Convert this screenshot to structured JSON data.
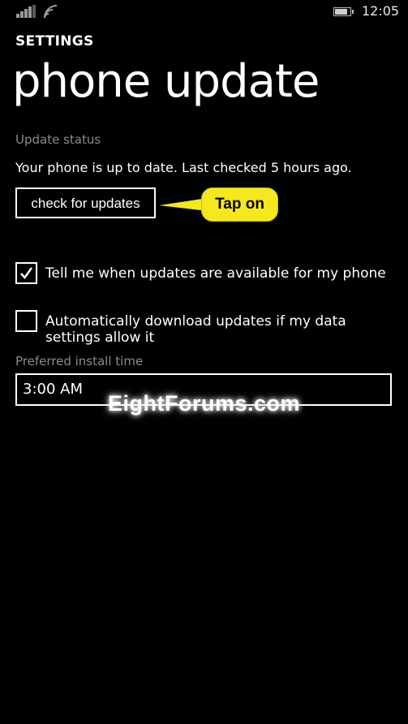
{
  "status_bar": {
    "time": "12:05",
    "battery_level": 0.85,
    "signal_icon": "signal-bars-icon",
    "wifi_icon": "wifi-icon",
    "battery_icon": "battery-icon"
  },
  "header": {
    "app_title": "SETTINGS",
    "page_title": "phone update"
  },
  "update": {
    "status_label": "Update status",
    "status_text": "Your phone is up to date. Last checked 5 hours ago.",
    "check_button_label": "check for updates"
  },
  "callout": {
    "text": "Tap on",
    "color": "#f5e81c"
  },
  "options": {
    "notify": {
      "label": "Tell me when updates are available for my phone",
      "checked": true
    },
    "auto_download": {
      "label": "Automatically download updates if my data settings allow it",
      "checked": false
    }
  },
  "install_time": {
    "label": "Preferred install time",
    "value": "3:00 AM"
  },
  "watermark": {
    "text": "EightForums.com"
  }
}
